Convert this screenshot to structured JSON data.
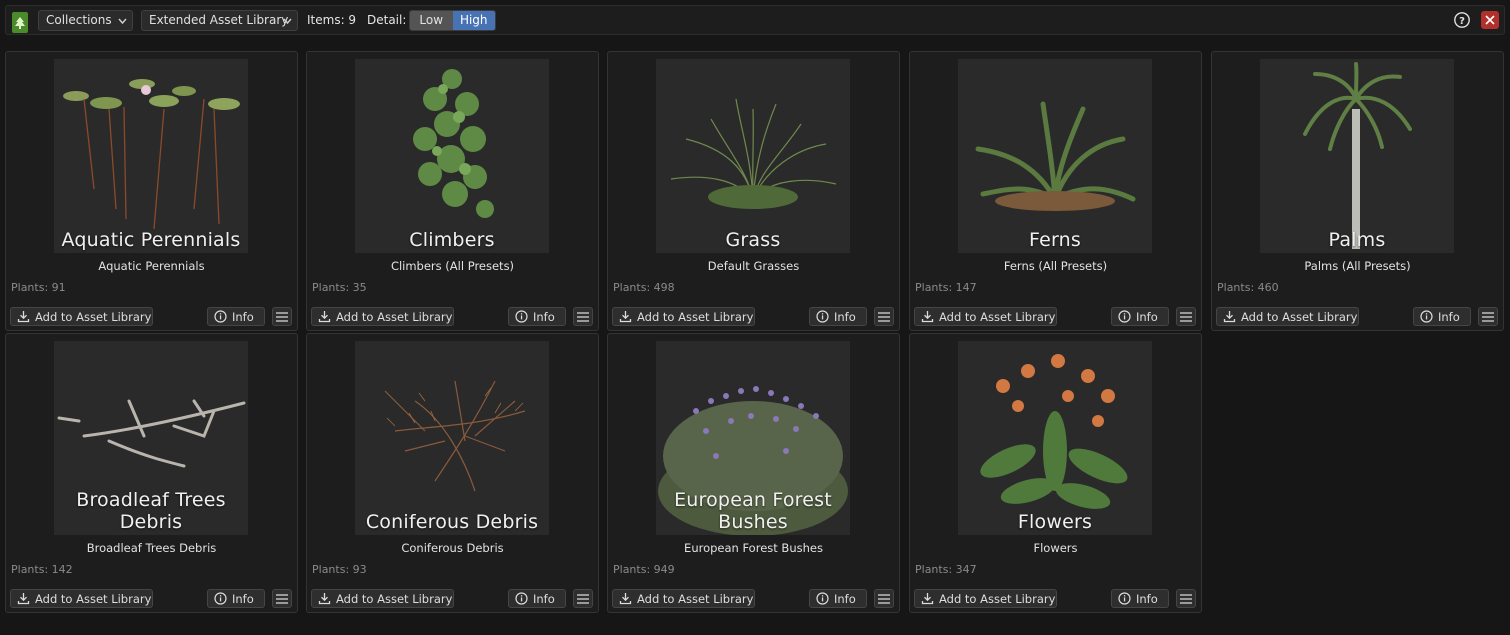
{
  "header": {
    "collections_label": "Collections",
    "library_label": "Extended Asset Library",
    "items_label": "Items: 9",
    "detail_label": "Detail:",
    "detail_options": [
      "Low",
      "High"
    ],
    "detail_selected": "High",
    "help_symbol": "?",
    "close_symbol": "✕"
  },
  "buttons": {
    "add_label": "Add to Asset Library",
    "info_label": "Info"
  },
  "colors": {
    "accent": "#4772b3",
    "close": "#b0302b",
    "logo": "#4a8a2a"
  },
  "cards": [
    {
      "thumb_title": "Aquatic Perennials",
      "name": "Aquatic Perennials",
      "plants": "Plants: 91"
    },
    {
      "thumb_title": "Climbers",
      "name": "Climbers (All Presets)",
      "plants": "Plants: 35"
    },
    {
      "thumb_title": "Grass",
      "name": "Default Grasses",
      "plants": "Plants: 498"
    },
    {
      "thumb_title": "Ferns",
      "name": "Ferns (All Presets)",
      "plants": "Plants: 147"
    },
    {
      "thumb_title": "Palms",
      "name": "Palms (All Presets)",
      "plants": "Plants: 460"
    },
    {
      "thumb_title": "Broadleaf Trees Debris",
      "name": "Broadleaf Trees Debris",
      "plants": "Plants: 142"
    },
    {
      "thumb_title": "Coniferous Debris",
      "name": "Coniferous Debris",
      "plants": "Plants: 93"
    },
    {
      "thumb_title": "European Forest Bushes",
      "name": "European Forest Bushes",
      "plants": "Plants: 949"
    },
    {
      "thumb_title": "Flowers",
      "name": "Flowers",
      "plants": "Plants: 347"
    }
  ]
}
